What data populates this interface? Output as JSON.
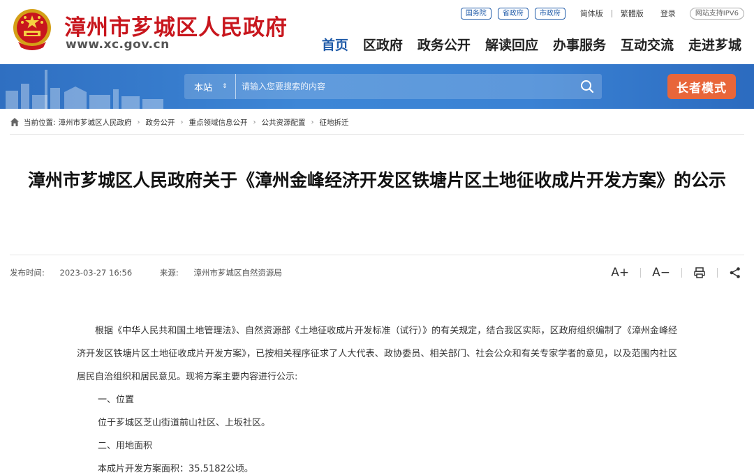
{
  "header": {
    "site_name": "漳州市芗城区人民政府",
    "site_url": "www.xc.gov.cn",
    "top_links": [
      "国务院",
      "省政府",
      "市政府"
    ],
    "lang_simplified": "简体版",
    "lang_traditional": "繁體版",
    "login": "登录",
    "ipv6": "网站支持IPV6",
    "nav": [
      "首页",
      "区政府",
      "政务公开",
      "解读回应",
      "办事服务",
      "互动交流",
      "走进芗城"
    ],
    "active_nav": "首页"
  },
  "search": {
    "scope": "本站",
    "placeholder": "请输入您要搜索的内容"
  },
  "elder_mode": "长者模式",
  "breadcrumb": {
    "label": "当前位置:",
    "items": [
      "漳州市芗城区人民政府",
      "政务公开",
      "重点领域信息公开",
      "公共资源配置",
      "征地拆迁"
    ]
  },
  "article": {
    "title": "漳州市芗城区人民政府关于《漳州金峰经济开发区铁塘片区土地征收成片开发方案》的公示",
    "publish_label": "发布时间:",
    "publish_time": "2023-03-27 16:56",
    "source_label": "来源:",
    "source": "漳州市芗城区自然资源局",
    "font_increase": "A+",
    "font_decrease": "A−",
    "paragraph1": "根据《中华人民共和国土地管理法》、自然资源部《土地征收成片开发标准（试行）》的有关规定，结合我区实际，区政府组织编制了《漳州金峰经济开发区铁塘片区土地征收成片开发方案》，已按相关程序征求了人大代表、政协委员、相关部门、社会公众和有关专家学者的意见，以及范围内社区居民自治组织和居民意见。现将方案主要内容进行公示:",
    "section1_title": "一、位置",
    "section1_text": "位于芗城区芝山街道前山社区、上坂社区。",
    "section2_title": "二、用地面积",
    "section2_text": "本成片开发方案面积：35.5182公顷。"
  },
  "colors": {
    "brand_red": "#c8161d",
    "brand_blue": "#1e5aa8",
    "banner_blue": "#3a82d4",
    "elder_orange": "#e8663a"
  },
  "icons": [
    "national-emblem-icon",
    "search-icon",
    "home-icon",
    "print-icon",
    "share-icon"
  ]
}
